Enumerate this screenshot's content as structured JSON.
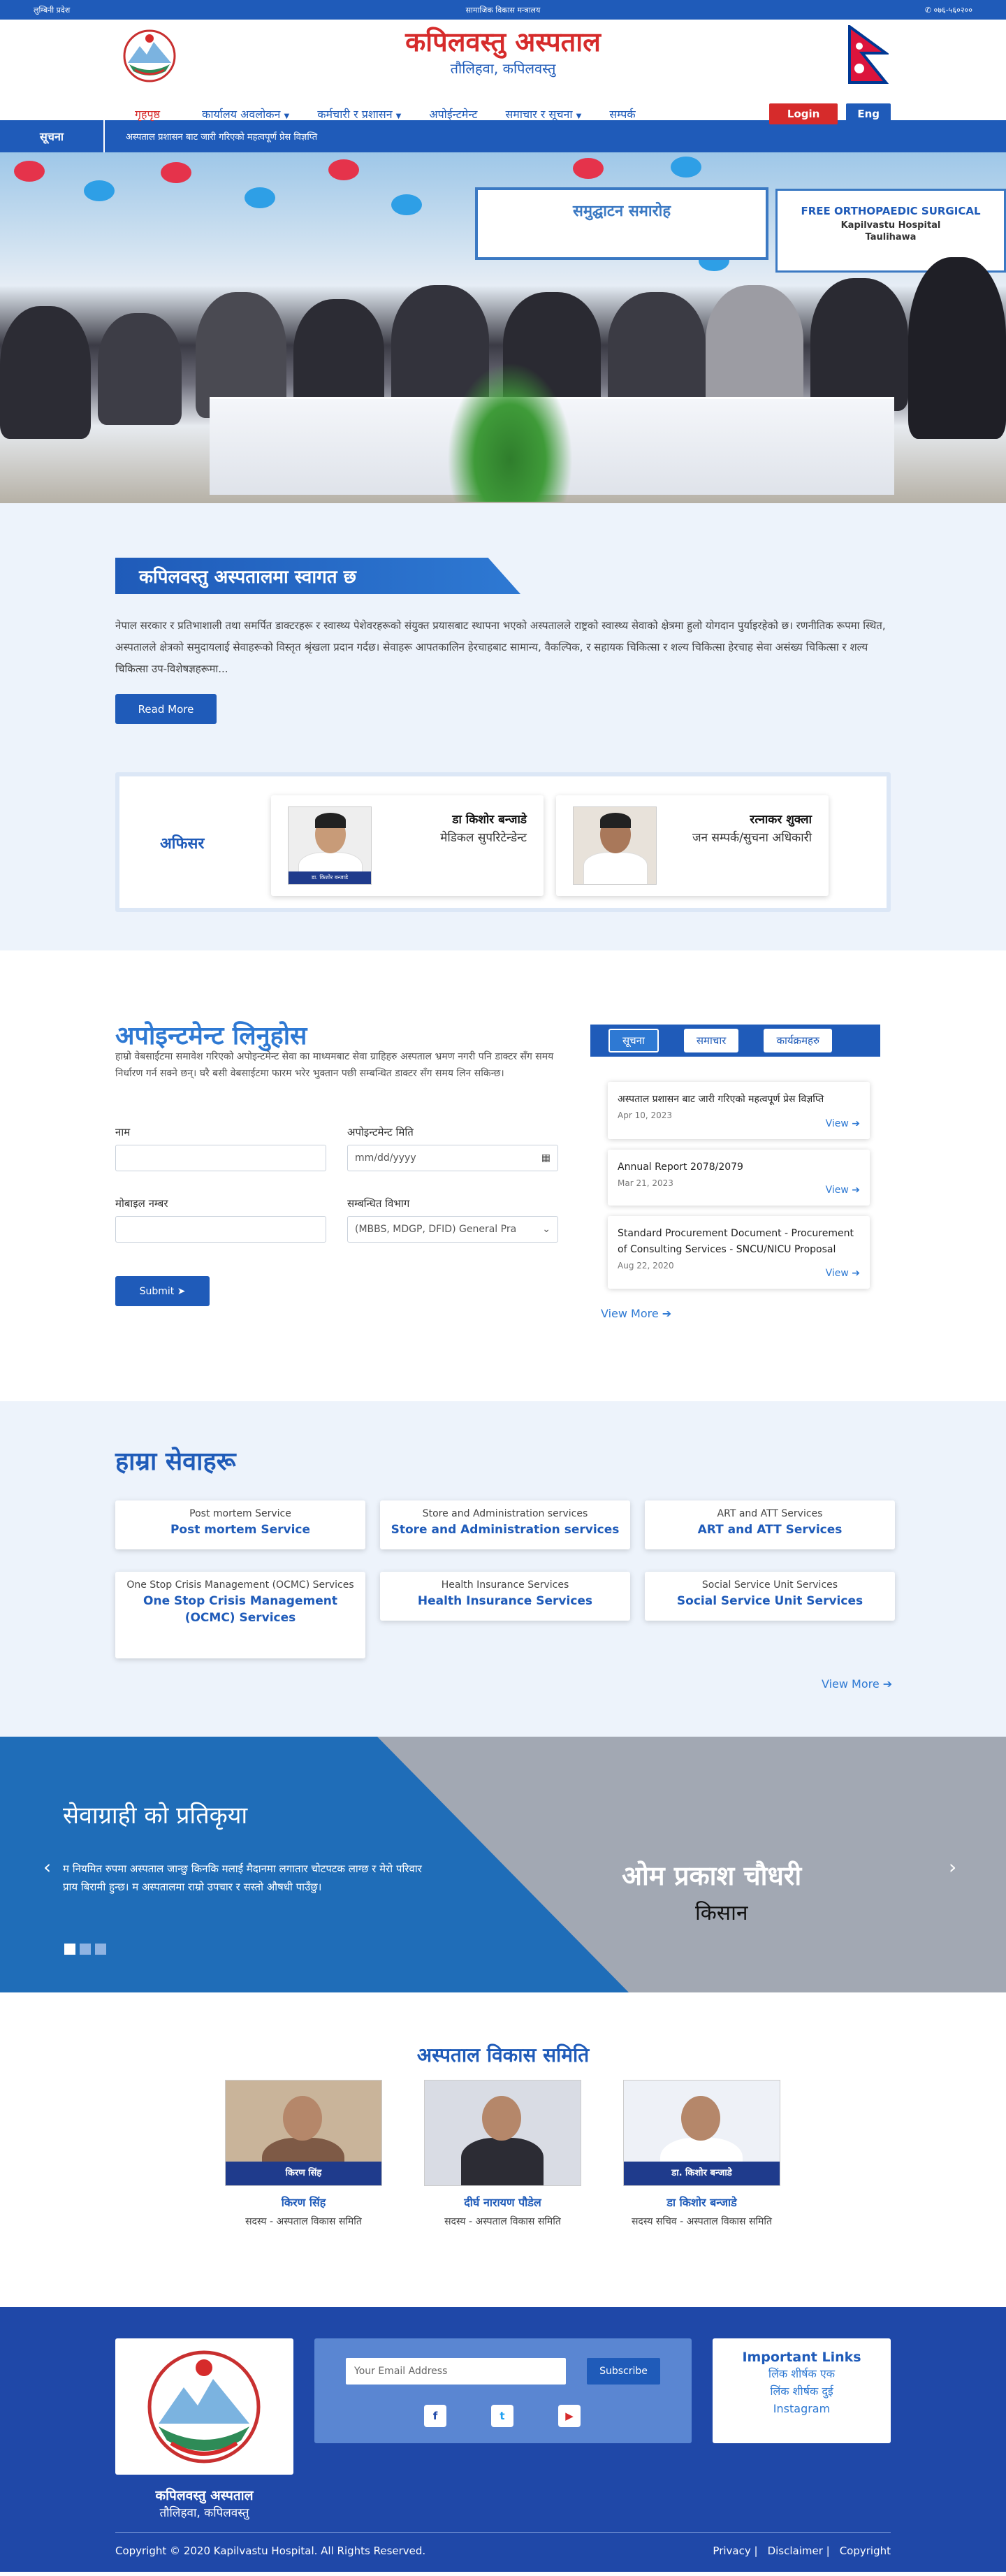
{
  "topbar": {
    "province": "लुम्बिनी प्रदेश",
    "ministry": "सामाजिक विकास मन्त्रालय",
    "phone": "०७६-५६०२००",
    "phone_icon": "phone-icon"
  },
  "header": {
    "title": "कपिलवस्तु अस्पताल",
    "subtitle": "तौलिहवा, कपिलवस्तु"
  },
  "nav": {
    "items": [
      {
        "label": "गृहपृष्ठ",
        "dropdown": false
      },
      {
        "label": "कार्यालय अवलोकन",
        "dropdown": true
      },
      {
        "label": "कर्मचारी र प्रशासन",
        "dropdown": true
      },
      {
        "label": "अपोईन्टमेन्ट",
        "dropdown": false
      },
      {
        "label": "समाचार र सूचना",
        "dropdown": true
      },
      {
        "label": "सम्पर्क",
        "dropdown": false
      }
    ],
    "login": "Login",
    "lang": "Eng"
  },
  "ticker": {
    "label": "सूचना",
    "message": "अस्पताल प्रशासन बाट जारी गरिएको महत्वपूर्ण प्रेस विज्ञप्ति"
  },
  "hero": {
    "banner": "समुद्घाटन समारोह",
    "banner2_line1": "FREE ORTHOPAEDIC SURGICAL",
    "banner2_line2": "Kapilvastu Hospital",
    "banner2_line3": "Taulihawa"
  },
  "welcome": {
    "title": "कपिलवस्तु अस्पतालमा स्वागत छ",
    "text": "नेपाल सरकार र प्रतिभाशाली तथा समर्पित डाक्टरहरू र स्वास्थ्य पेशेवरहरूको संयुक्त प्रयासबाट स्थापना भएको अस्पतालले राष्ट्रको स्वास्थ्य सेवाको क्षेत्रमा हुलो योगदान पुर्याइरहेको छ। रणनीतिक रूपमा स्थित, अस्पतालले क्षेत्रको समुदायलाई सेवाहरूको विस्तृत श्रृंखला प्रदान गर्दछ। सेवाहरू आपतकालिन हेरचाहबाट सामान्य, वैकल्पिक, र सहायक चिकित्सा र शल्य चिकित्सा हेरचाह सेवा असंख्य चिकित्सा र शल्य चिकित्सा उप-विशेषज्ञहरूमा...",
    "read_more": "Read More"
  },
  "officers": {
    "label": "अफिसर",
    "cards": [
      {
        "name": "डा किशोर बन्जाडे",
        "role": "मेडिकल सुपरिटेन्डेन्ट",
        "photo_tag": "डा. किशोर बन्जाडे"
      },
      {
        "name": "रत्नाकर शुक्ला",
        "role": "जन सम्पर्क/सुचना अधिकारी",
        "photo_tag": ""
      }
    ]
  },
  "appointment": {
    "title": "अपोइन्टमेन्ट लिनुहोस",
    "description": "हाम्रो वेबसाईटमा समावेश गरिएको अपोइन्टमेन्ट सेवा का माध्यमबाट सेवा ग्राहिहरु अस्पताल भ्रमण नगरी पनि डाक्टर सँग समय निर्धारण गर्न सक्ने छन्। घरै बसी वेबसाईटमा फारम भरेर भुक्तान पछी सम्बन्धित डाक्टर सँग समय लिन सकिन्छ।",
    "name_label": "नाम",
    "date_label": "अपोइन्टमेन्ट मिति",
    "date_placeholder": "mm/dd/yyyy",
    "mobile_label": "मोबाइल नम्बर",
    "dept_label": "सम्बन्धित विभाग",
    "dept_value": "(MBBS, MDGP, DFID) General Pra",
    "submit": "Submit"
  },
  "notices": {
    "tabs": [
      "सूचना",
      "समाचार",
      "कार्यक्रमहरु"
    ],
    "items": [
      {
        "title": "अस्पताल प्रशासन बाट जारी गरिएको महत्वपूर्ण प्रेस विज्ञप्ति",
        "date": "Apr 10, 2023"
      },
      {
        "title": "Annual Report 2078/2079",
        "date": "Mar 21, 2023"
      },
      {
        "title": "Standard Procurement Document - Procurement of Consulting Services - SNCU/NICU Proposal",
        "date": "Aug 22, 2020"
      }
    ],
    "view": "View",
    "view_more": "View More"
  },
  "services": {
    "title": "हाम्रा सेवाहरू",
    "items": [
      {
        "alt": "Post mortem Service",
        "title": "Post mortem Service"
      },
      {
        "alt": "Store and Administration services",
        "title": "Store and Administration services"
      },
      {
        "alt": "ART and ATT Services",
        "title": "ART and ATT Services"
      },
      {
        "alt": "One Stop Crisis Management (OCMC) Services",
        "title": "One Stop Crisis Management (OCMC) Services"
      },
      {
        "alt": "Health Insurance Services",
        "title": "Health Insurance Services"
      },
      {
        "alt": "Social Service Unit Services",
        "title": "Social Service Unit Services"
      }
    ],
    "view_more": "View More"
  },
  "testimonial": {
    "title": "सेवाग्राही को प्रतिकृया",
    "quote": "म नियमित रुपमा अस्पताल जान्छु किनकि मलाई मैदानमा लगातार चोटपटक लाग्छ र मेरो परिवार प्राय बिरामी हुन्छ। म अस्पतालमा राम्रो उपचार र सस्तो औषधी पाउँछु।",
    "name": "ओम प्रकाश चौधरी",
    "role": "किसान"
  },
  "committee": {
    "title": "अस्पताल विकास समिति",
    "members": [
      {
        "name": "किरण सिंह",
        "role": "सदस्य - अस्पताल विकास समिति",
        "tag": "किरण सिंह"
      },
      {
        "name": "दीर्घ नारायण पौडेल",
        "role": "सदस्य - अस्पताल विकास समिति",
        "tag": ""
      },
      {
        "name": "डा किशोर बन्जाडे",
        "role": "सदस्य सचिव - अस्पताल विकास समिति",
        "tag": "डा. किशोर बन्जाडे"
      }
    ]
  },
  "footer": {
    "name": "कपिलवस्तु अस्पताल",
    "address": "तौलिहवा, कपिलवस्तु",
    "email_placeholder": "Your Email Address",
    "subscribe": "Subscribe",
    "social": [
      "facebook-icon",
      "twitter-icon",
      "youtube-icon"
    ],
    "links_title": "Important Links",
    "links": [
      "लिंक शीर्षक एक",
      "लिंक शीर्षक दुई",
      "Instagram"
    ],
    "copyright": "Copyright © 2020 Kapilvastu Hospital. All Rights Reserved.",
    "bottom_links": [
      "Privacy |",
      "Disclaimer |",
      "Copyright"
    ]
  },
  "colors": {
    "primary": "#1f5bb9",
    "accent": "#d62b2b",
    "light_bg": "#edf3fb",
    "footer_bg": "#1f48a8"
  }
}
